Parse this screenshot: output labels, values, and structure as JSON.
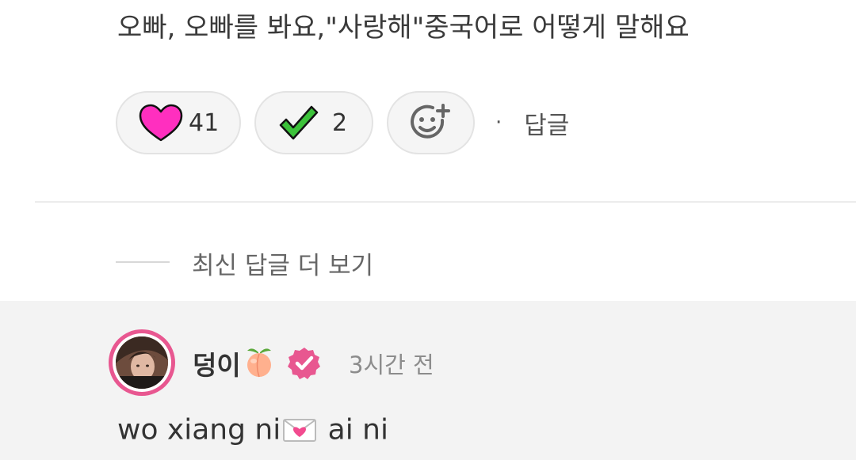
{
  "top_comment": {
    "text": "오빠, 오빠를 봐요,\"사랑해\"중국어로 어떻게 말해요",
    "reactions": {
      "heart": {
        "icon": "heart-icon",
        "count": "41",
        "color": "#ff2fbf"
      },
      "check": {
        "icon": "check-icon",
        "count": "2",
        "color": "#3cc23a"
      },
      "add": {
        "icon": "add-reaction-icon"
      }
    },
    "separator": "·",
    "reply_label": "답글"
  },
  "more_replies_label": "최신 답글 더 보기",
  "reply": {
    "username": "덩이",
    "username_emoji_icon": "peach-icon",
    "badge_icon": "verified-badge-icon",
    "time": "3시간 전",
    "text_before": "wo xiang ni",
    "text_emoji_icon": "love-letter-icon",
    "text_after": "ai ni",
    "accent_color": "#e85790"
  }
}
